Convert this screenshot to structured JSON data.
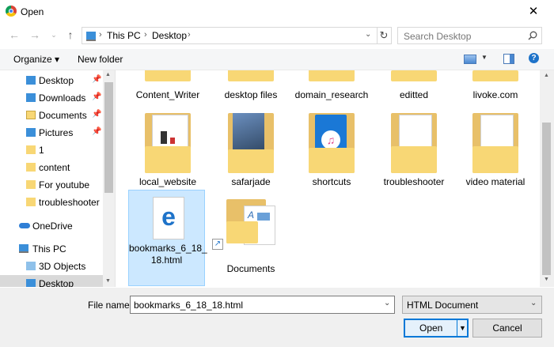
{
  "window": {
    "title": "Open",
    "close_glyph": "✕"
  },
  "address": {
    "path": [
      "This PC",
      "Desktop"
    ],
    "search_placeholder": "Search Desktop"
  },
  "toolbar": {
    "organize": "Organize ▾",
    "new_folder": "New folder"
  },
  "sidebar": {
    "items": [
      {
        "label": "Desktop",
        "pinned": true
      },
      {
        "label": "Downloads",
        "pinned": true
      },
      {
        "label": "Documents",
        "pinned": true
      },
      {
        "label": "Pictures",
        "pinned": true
      },
      {
        "label": "1",
        "pinned": false
      },
      {
        "label": "content",
        "pinned": false
      },
      {
        "label": "For youtube",
        "pinned": false
      },
      {
        "label": "troubleshooter",
        "pinned": false
      },
      {
        "label": "OneDrive",
        "pinned": false
      },
      {
        "label": "This PC",
        "pinned": false
      },
      {
        "label": "3D Objects",
        "pinned": false
      },
      {
        "label": "Desktop",
        "pinned": false
      }
    ]
  },
  "files": {
    "row1": [
      "Content_Writer",
      "desktop files",
      "domain_research",
      "editted",
      "livoke.com"
    ],
    "row2": [
      "local_website",
      "safarjade",
      "shortcuts",
      "troubleshooter",
      "video material"
    ],
    "row3": [
      "bookmarks_6_18_\n18.html",
      "Documents"
    ]
  },
  "bottom": {
    "filename_label": "File name:",
    "filename_value": "bookmarks_6_18_18.html",
    "filetype": "HTML Document",
    "open": "Open",
    "cancel": "Cancel"
  },
  "colors": {
    "accent": "#0078d7",
    "folder": "#f8d775",
    "selected_bg": "#cce8ff",
    "selected_border": "#99d1ff"
  }
}
